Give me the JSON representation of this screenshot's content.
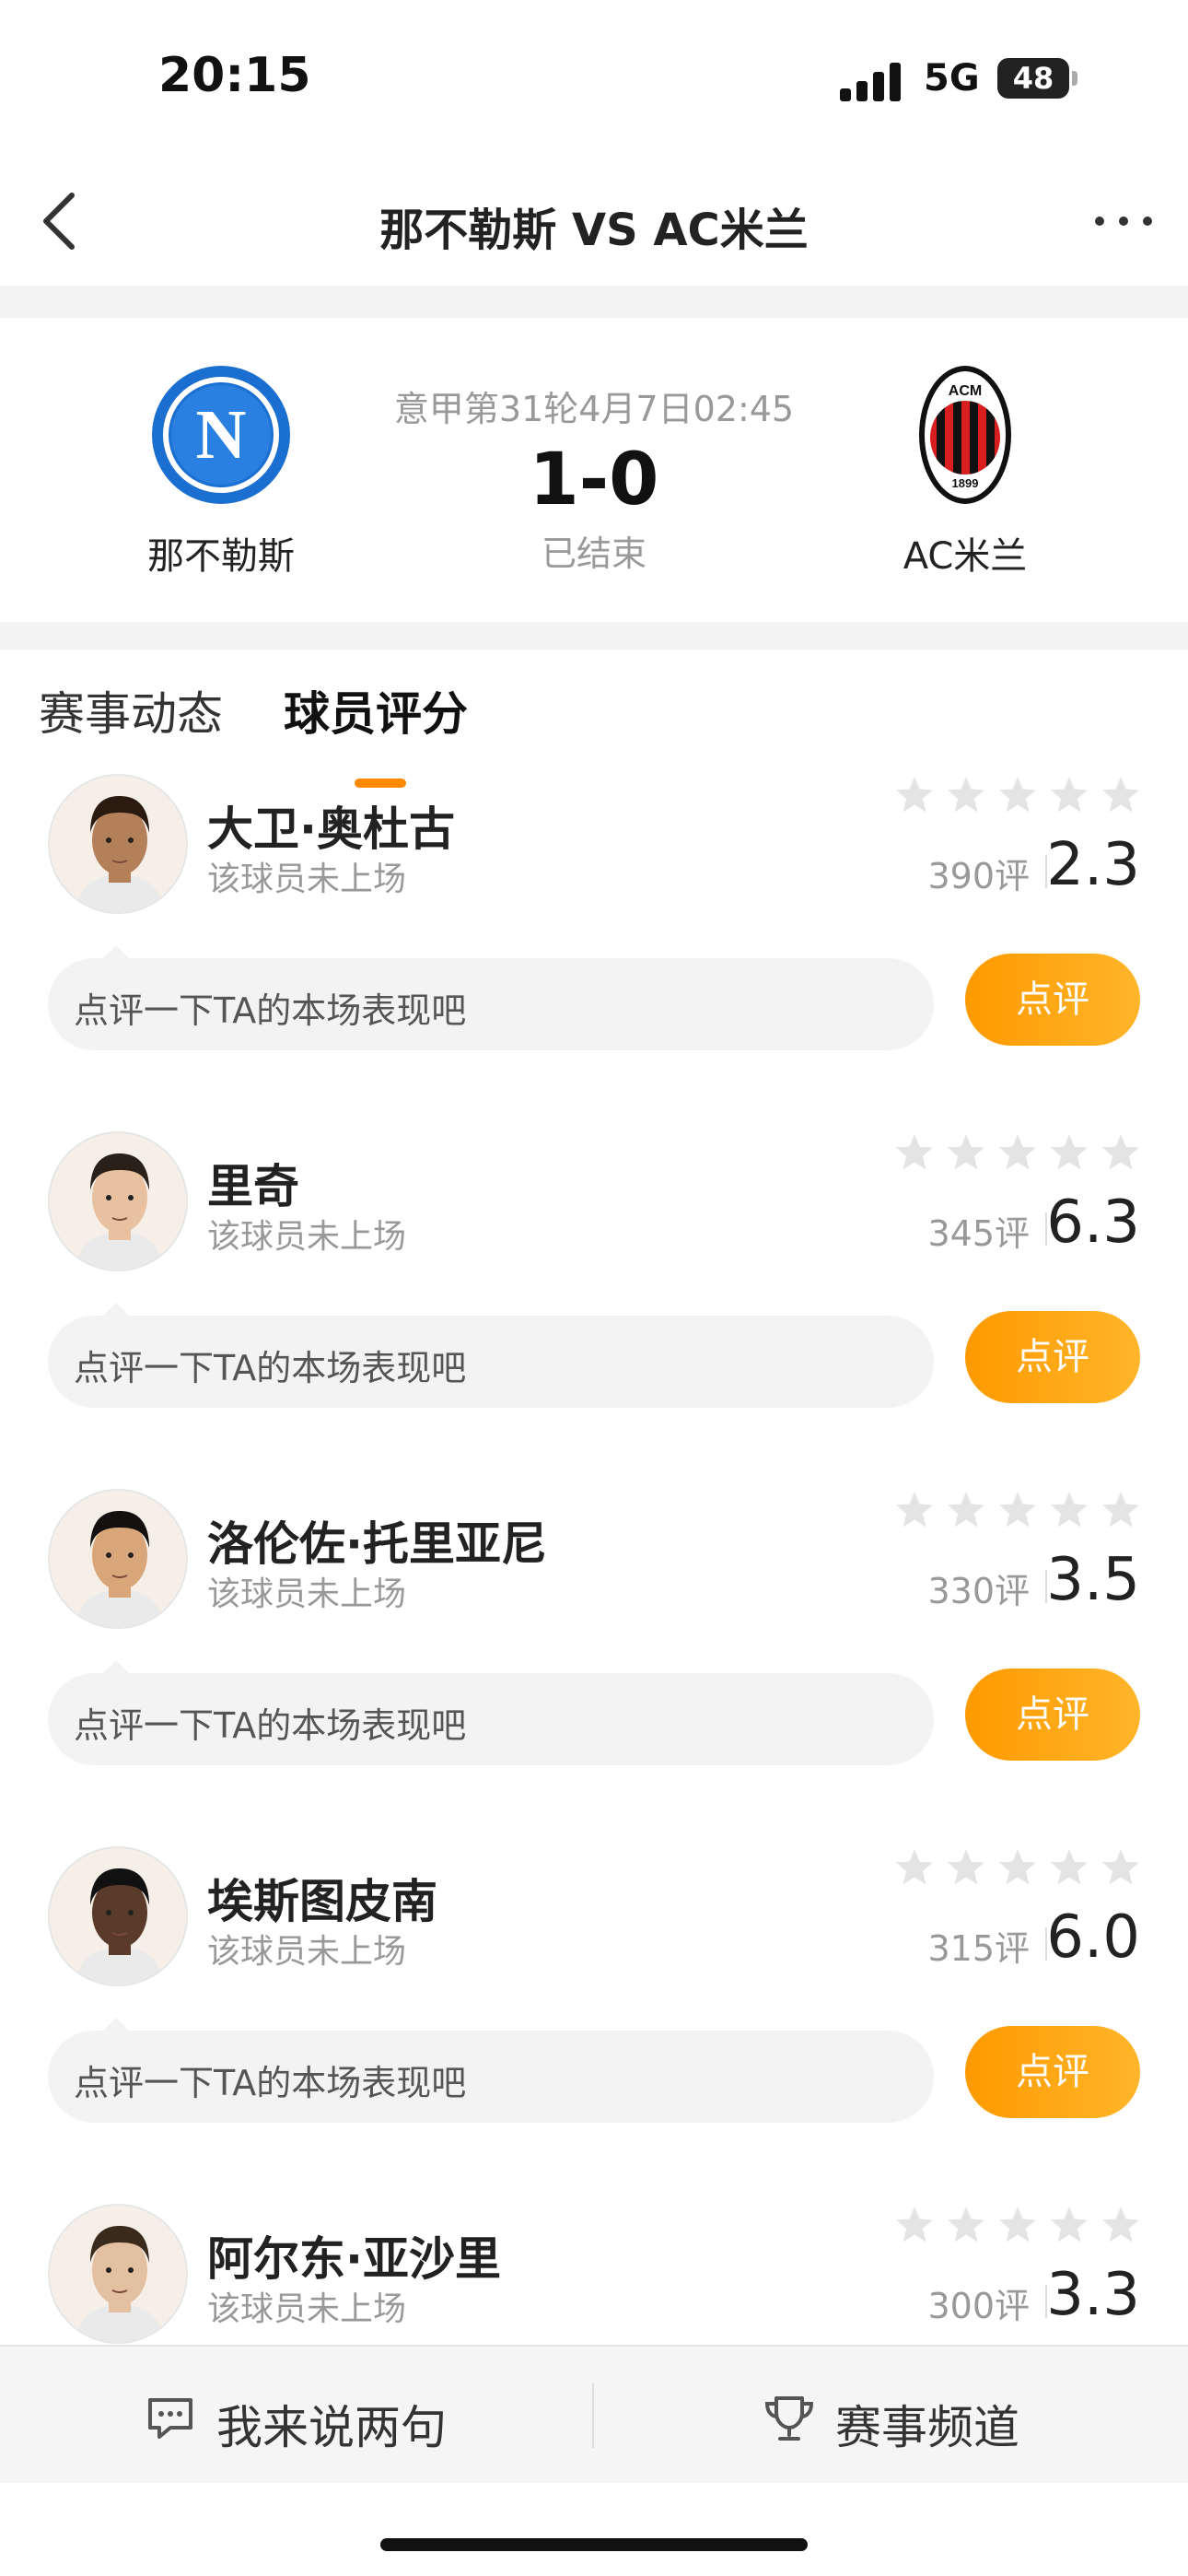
{
  "status_bar": {
    "time": "20:15",
    "network": "5G",
    "battery": "48"
  },
  "nav": {
    "title": "那不勒斯 VS AC米兰",
    "back_icon": "chevron-left-icon",
    "more_icon": "more-dots-icon"
  },
  "match": {
    "league_time": "意甲第31轮4月7日02:45",
    "score": "1-0",
    "state": "已结束",
    "home": {
      "name": "那不勒斯",
      "logo_letter": "N",
      "logo_color": "#1a6fd0"
    },
    "away": {
      "name": "AC米兰",
      "logo_text": "ACM",
      "logo_year": "1899",
      "logo_color": "#d81e1e"
    }
  },
  "tabs": [
    {
      "label": "赛事动态",
      "active": false
    },
    {
      "label": "球员评分",
      "active": true
    }
  ],
  "accent_color": "#ff9a00",
  "players": [
    {
      "name": "大卫·奥杜古",
      "status": "该球员未上场",
      "rating_count": "390评",
      "score": "2.3",
      "comment_placeholder": "点评一下TA的本场表现吧",
      "button": "点评"
    },
    {
      "name": "里奇",
      "status": "该球员未上场",
      "rating_count": "345评",
      "score": "6.3",
      "comment_placeholder": "点评一下TA的本场表现吧",
      "button": "点评"
    },
    {
      "name": "洛伦佐·托里亚尼",
      "status": "该球员未上场",
      "rating_count": "330评",
      "score": "3.5",
      "comment_placeholder": "点评一下TA的本场表现吧",
      "button": "点评"
    },
    {
      "name": "埃斯图皮南",
      "status": "该球员未上场",
      "rating_count": "315评",
      "score": "6.0",
      "comment_placeholder": "点评一下TA的本场表现吧",
      "button": "点评"
    },
    {
      "name": "阿尔东·亚沙里",
      "status": "该球员未上场",
      "rating_count": "300评",
      "score": "3.3",
      "comment_placeholder": "点评一下TA的本场表现吧",
      "button": "点评"
    }
  ],
  "bottom_bar": {
    "left": {
      "label": "我来说两句",
      "icon": "comment-icon"
    },
    "right": {
      "label": "赛事频道",
      "icon": "trophy-icon"
    }
  }
}
